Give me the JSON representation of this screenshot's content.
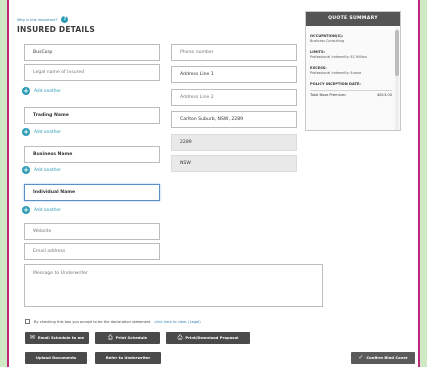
{
  "header": {
    "why_link": "Why is this important?",
    "help_glyph": "?",
    "title": "INSURED DETAILS"
  },
  "form": {
    "business_name": "BusCorp",
    "legal_name_placeholder": "Legal name of insured",
    "add_another": "Add another",
    "trading_name": "Trading Name",
    "business_name_field": "Business Name",
    "individual_name": "Individual Name",
    "website_placeholder": "Website",
    "email_placeholder": "Email address",
    "phone_placeholder": "Phone number",
    "address1": "Address Line 1",
    "address2_placeholder": "Address Line 2",
    "suburb": "Carlton Suburb, NSW, 2289",
    "postcode": "2289",
    "state": "NSW",
    "message_placeholder": "Message to Underwriter"
  },
  "summary": {
    "heading": "QUOTE SUMMARY",
    "occupation_label": "OCCUPATION(S):",
    "occupation_value": "Business Consulting",
    "limits_label": "LIMITS:",
    "limits_value": "Professional Indemnity: $1 Million",
    "excess_label": "EXCESS:",
    "excess_value": "Professional Indemnity: $none",
    "policy_label": "POLICY INCEPTION DATE:",
    "total_label": "Total Base Premium:",
    "total_value": "$813.00"
  },
  "declaration": {
    "text": "By checking this box you accept to be the declaration statement",
    "link": "click here to view, (Legal)"
  },
  "buttons": {
    "email": "Email Schedule to me",
    "print": "Print Schedule",
    "proposal": "Print/Download Proposal",
    "upload": "Upload Documents",
    "refer": "Refer to Underwriter",
    "confirm": "Confirm Bind Cover"
  },
  "icons": {
    "plus": "+",
    "mail": "✉",
    "printer": "⎙",
    "check": "✓"
  }
}
